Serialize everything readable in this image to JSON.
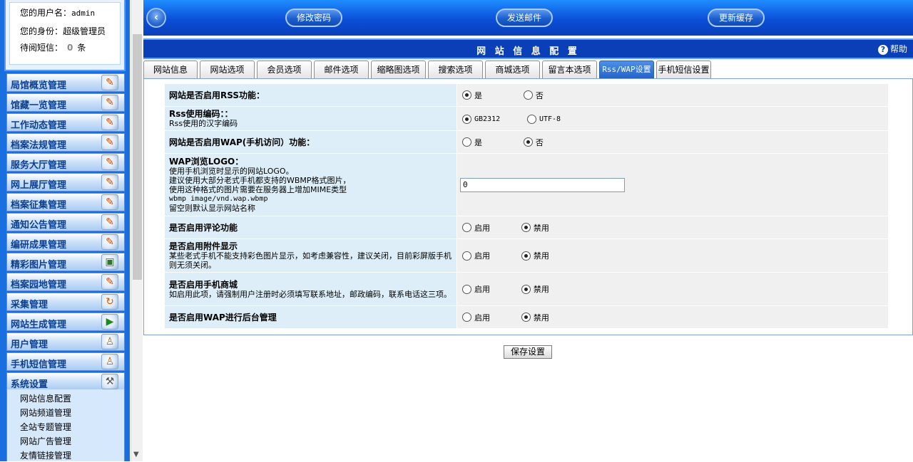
{
  "user": {
    "username_label": "您的用户名：",
    "username": "admin",
    "role_label": "您的身份：",
    "role": "超级管理员",
    "messages_label": "待阅短信：",
    "messages_count": "0",
    "messages_unit": "条"
  },
  "sidebar": {
    "items": [
      {
        "label": "局馆概览管理",
        "icon": "edit-icon"
      },
      {
        "label": "馆藏一览管理",
        "icon": "edit-icon"
      },
      {
        "label": "工作动态管理",
        "icon": "edit-icon"
      },
      {
        "label": "档案法规管理",
        "icon": "edit-icon"
      },
      {
        "label": "服务大厅管理",
        "icon": "edit-icon"
      },
      {
        "label": "网上展厅管理",
        "icon": "edit-icon"
      },
      {
        "label": "档案征集管理",
        "icon": "edit-icon"
      },
      {
        "label": "通知公告管理",
        "icon": "edit-icon"
      },
      {
        "label": "编研成果管理",
        "icon": "edit-icon"
      },
      {
        "label": "精彩图片管理",
        "icon": "image-icon"
      },
      {
        "label": "档案园地管理",
        "icon": "edit-icon"
      },
      {
        "label": "采集管理",
        "icon": "refresh-icon"
      },
      {
        "label": "网站生成管理",
        "icon": "play-icon"
      },
      {
        "label": "用户管理",
        "icon": "user-icon"
      },
      {
        "label": "手机短信管理",
        "icon": "user-icon"
      },
      {
        "label": "系统设置",
        "icon": "tools-icon"
      }
    ],
    "submenu": [
      "网站信息配置",
      "网站频道管理",
      "全站专题管理",
      "网站广告管理",
      "友情链接管理"
    ]
  },
  "toolbar": {
    "change_password": "修改密码",
    "send_mail": "发送邮件",
    "update_cache": "更新缓存"
  },
  "page": {
    "title": "网 站 信 息 配 置",
    "help": "帮助"
  },
  "tabs": [
    "网站信息",
    "网站选项",
    "会员选项",
    "邮件选项",
    "缩略图选项",
    "搜索选项",
    "商城选项",
    "留言本选项",
    "Rss/WAP设置",
    "手机短信设置"
  ],
  "active_tab": "Rss/WAP设置",
  "form": {
    "rss_enable": {
      "label": "网站是否启用RSS功能：",
      "opt_yes": "是",
      "opt_no": "否",
      "value": "是"
    },
    "rss_encoding": {
      "label": "Rss使用编码：：",
      "desc": "Rss使用的汉字编码",
      "opt_a": "GB2312",
      "opt_b": "UTF-8",
      "value": "GB2312"
    },
    "wap_enable": {
      "label": "网站是否启用WAP(手机访问）功能：",
      "opt_yes": "是",
      "opt_no": "否",
      "value": "否"
    },
    "wap_logo": {
      "label": "WAP浏览LOGO：",
      "desc1": "使用手机浏览时显示的网站LOGO。",
      "desc2": "建议使用大部分老式手机都支持的WBMP格式图片，",
      "desc3": "使用这种格式的图片需要在服务器上增加MIME类型",
      "desc4": "wbmp image/vnd.wap.wbmp",
      "desc5": "留空则默认显示网站名称",
      "value": "0"
    },
    "comment_enable": {
      "label": "是否启用评论功能",
      "opt_on": "启用",
      "opt_off": "禁用",
      "value": "禁用"
    },
    "attach_enable": {
      "label": "是否启用附件显示",
      "desc": "某些老式手机不能支持彩色图片显示，如考虑兼容性，建议关闭，目前彩屏版手机则无须关闭。",
      "opt_on": "启用",
      "opt_off": "禁用",
      "value": "禁用"
    },
    "mall_enable": {
      "label": "是否启用手机商城",
      "desc": "如启用此项，请强制用户注册时必须填写联系地址，邮政编码，联系电话这三项。",
      "opt_on": "启用",
      "opt_off": "禁用",
      "value": "禁用"
    },
    "wap_admin": {
      "label": "是否启用WAP进行后台管理",
      "opt_on": "启用",
      "opt_off": "禁用",
      "value": "禁用"
    }
  },
  "save_button": "保存设置"
}
